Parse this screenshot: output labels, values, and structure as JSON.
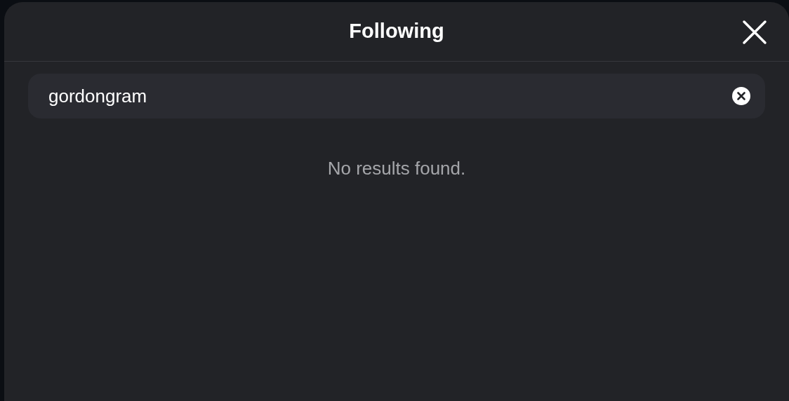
{
  "dialog": {
    "title": "Following"
  },
  "search": {
    "value": "gordongram"
  },
  "message": "No results found."
}
